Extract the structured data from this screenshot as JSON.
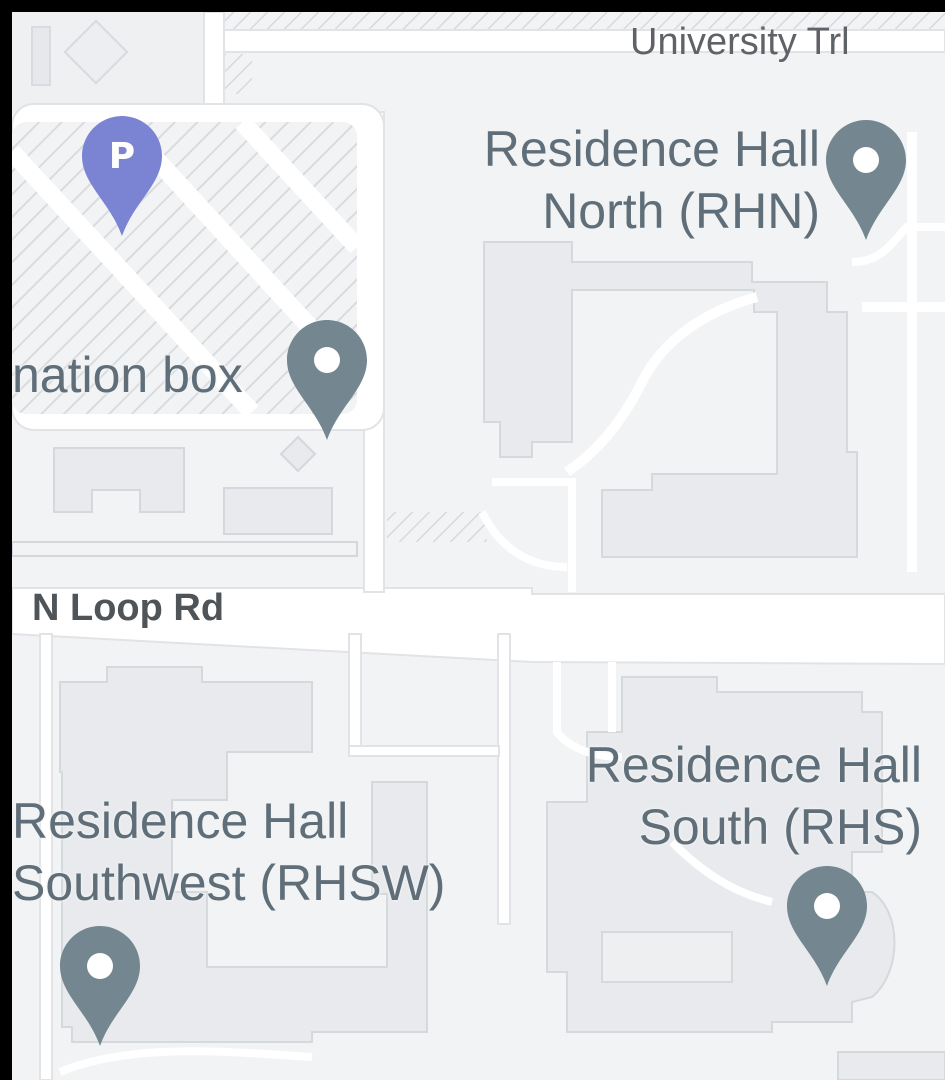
{
  "map": {
    "roads": {
      "university_trl": "University Trl",
      "n_loop_rd": "N Loop Rd"
    },
    "places": {
      "rhn": {
        "line1": "Residence Hall",
        "line2": "North (RHN)"
      },
      "info_box": "nation box",
      "rhsw": {
        "line1": "Residence Hall",
        "line2": "Southwest (RHSW)"
      },
      "rhs": {
        "line1": "Residence Hall",
        "line2": "South (RHS)"
      }
    },
    "parking": {
      "letter": "P",
      "icon": "parking-icon",
      "color": "#7b83d3"
    },
    "pin_color": "#74868f",
    "colors": {
      "background": "#f1f3f4",
      "road": "#ffffff",
      "building": "#e8eaed",
      "building_outline": "#d4d7db",
      "hatch": "#dadce0"
    }
  }
}
